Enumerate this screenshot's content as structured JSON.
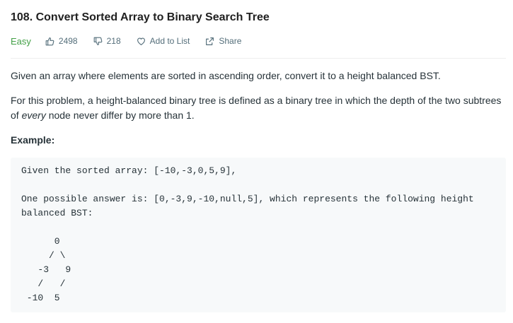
{
  "problem": {
    "title": "108. Convert Sorted Array to Binary Search Tree",
    "difficulty": "Easy",
    "likes": "2498",
    "dislikes": "218",
    "add_to_list": "Add to List",
    "share": "Share"
  },
  "description": {
    "para1": "Given an array where elements are sorted in ascending order, convert it to a height balanced BST.",
    "para2_before": "For this problem, a height-balanced binary tree is defined as a binary tree in which the depth of the two subtrees of ",
    "para2_em": "every",
    "para2_after": " node never differ by more than 1.",
    "example_label": "Example:",
    "example_code": "Given the sorted array: [-10,-3,0,5,9],\n\nOne possible answer is: [0,-3,9,-10,null,5], which represents the following height\nbalanced BST:\n\n      0\n     / \\\n   -3   9\n   /   /\n -10  5"
  },
  "colors": {
    "easy": "#43a047",
    "meta_text": "#546e7a",
    "code_bg": "#f7f9fa"
  },
  "icons": {
    "likes": "thumbs-up-icon",
    "dislikes": "thumbs-down-icon",
    "add_to_list": "heart-icon",
    "share": "share-icon"
  }
}
